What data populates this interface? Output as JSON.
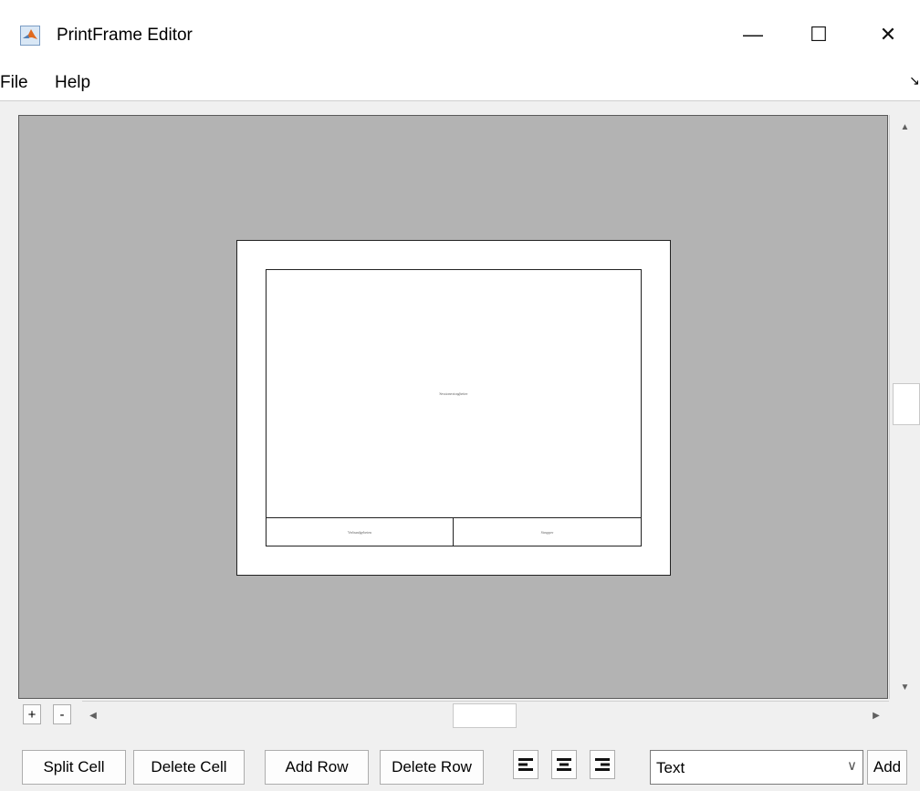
{
  "window": {
    "title": "PrintFrame Editor",
    "minimize": "—",
    "maximize": "☐",
    "close": "✕"
  },
  "menu": {
    "items": [
      "File",
      "Help"
    ],
    "arrow": "↘"
  },
  "page_preview": {
    "main_cell": "Sessionextraghetter",
    "bottom_left_cell": "Verbundgebeten",
    "bottom_right_cell": "Strupper"
  },
  "scroll": {
    "up": "▲",
    "down": "▼",
    "left": "◀",
    "right": "▶"
  },
  "zoom": {
    "in": "+",
    "out": "-"
  },
  "toolbar": {
    "split_cell": "Split Cell",
    "delete_cell": "Delete Cell",
    "add_row": "Add Row",
    "delete_row": "Delete Row",
    "type_select_value": "Text",
    "type_select_arrow": "∨",
    "add": "Add"
  },
  "icons": {
    "app": "matlab-icon",
    "align_left": "align-left-icon",
    "align_center": "align-center-icon",
    "align_right": "align-right-icon"
  },
  "colors": {
    "canvas_background": "#b3b3b3",
    "window_background": "#f0f0f0"
  }
}
